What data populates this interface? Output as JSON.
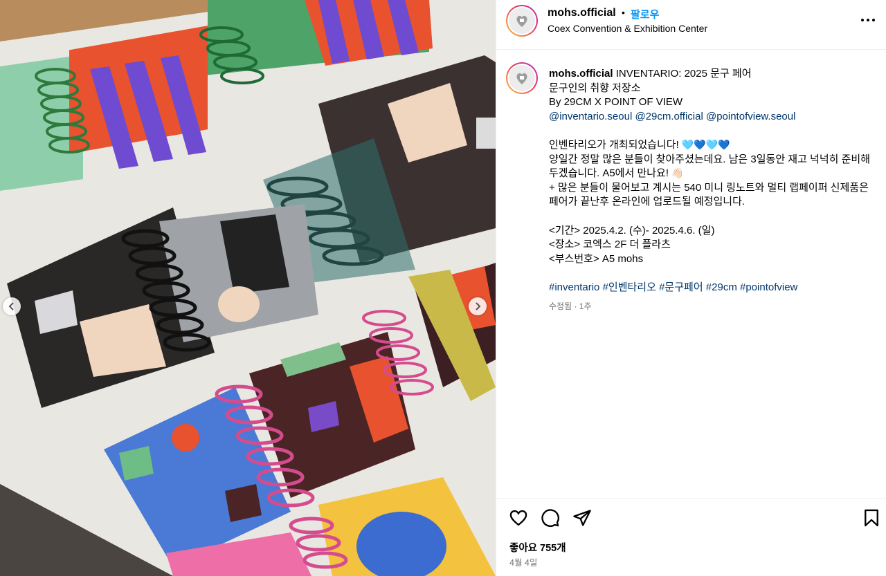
{
  "post": {
    "username": "mohs.official",
    "separator": "•",
    "follow_label": "팔로우",
    "location": "Coex Convention & Exhibition Center"
  },
  "caption": {
    "username": "mohs.official",
    "title_text": "INVENTARIO: 2025 문구 페어",
    "line2": "문구인의 취향 저장소",
    "line3": "By 29CM X POINT OF VIEW",
    "mentions": [
      "@inventario.seoul",
      "@29cm.official",
      "@pointofview.seoul"
    ],
    "para1_line1": "인벤타리오가 개최되었습니다! ",
    "para1_hearts": "🩵💙🩵💙",
    "para1_line2": "양일간 정말 많은 분들이 찾아주셨는데요. 남은 3일동안 재고 넉넉히 준비해",
    "para1_line3": "두겠습니다. A5에서 만나요! ",
    "para1_wave": "👋🏻",
    "para1_line4": "+ 많은 분들이 물어보고 계시는 540 미니 링노트와 멀티 랩페이퍼 신제품은",
    "para1_line5": "페어가 끝난후 온라인에 업로드될 예정입니다.",
    "period": "<기간> 2025.4.2. (수)- 2025.4.6. (일)",
    "venue": "<장소> 코엑스 2F 더 플라츠",
    "booth": "<부스번호> A5 mohs",
    "hashtags": [
      "#inventario",
      "#인벤타리오",
      "#문구페어",
      "#29cm",
      "#pointofview"
    ],
    "edited": "수정됨 · 1주"
  },
  "actions": {
    "likes": "좋아요 755개",
    "date": "4월 4일"
  },
  "icons": {
    "more": "more-options-icon",
    "like": "heart-icon",
    "comment": "comment-icon",
    "share": "share-icon",
    "save": "bookmark-icon",
    "prev": "chevron-left-icon",
    "next": "chevron-right-icon"
  },
  "colors": {
    "link": "#0095f6",
    "mention": "#00376b",
    "muted": "#737373",
    "border": "#efefef"
  }
}
